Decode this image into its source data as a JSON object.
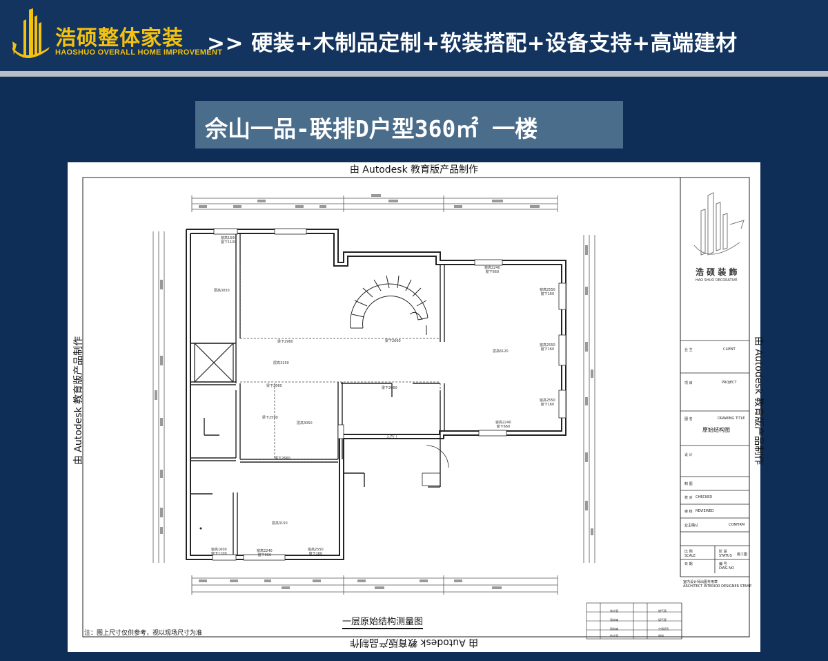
{
  "header": {
    "brand_cn": "浩硕整体家装",
    "brand_en": "HAOSHUO OVERALL HOME IMPROVEMENT",
    "tagline": ">> 硬装+木制品定制+软装搭配+设备支持+高端建材",
    "colors": {
      "background": "#12345f",
      "brand": "#f4c20d",
      "rule": "#b9bec6"
    }
  },
  "title": "佘山一品-联排D户型360㎡ 一楼",
  "sheet": {
    "watermark": "由 Autodesk 教育版产品制作",
    "caption": "一层原始结构测量图",
    "note": "注：图上尺寸仅供参考，视以现场尺寸为准",
    "entrance_label": "入户门",
    "rooms": [
      {
        "label": "层高3050"
      },
      {
        "label": "层高3150"
      },
      {
        "label": "层高6120"
      },
      {
        "label": "层高3050"
      },
      {
        "label": "层高3150"
      }
    ],
    "window_labels": [
      "窗高1600\n窗下1100",
      "窗高2240\n窗下660",
      "窗高2550\n窗下160",
      "窗高2550\n窗下160",
      "窗高2550\n窗下160",
      "窗高2240\n窗下660",
      "窗高1600\n窗下1100",
      "窗高2240\n窗下660",
      "窗高2550\n窗下160"
    ],
    "beam_labels": [
      "梁下2960",
      "梁下2660",
      "梁下2660",
      "梁下2660",
      "梁下2590",
      "梁下2660"
    ]
  },
  "title_block": {
    "brand_cn": "浩 硕 装 飾",
    "brand_en": "HAO SHUO DECORATIVE",
    "client_cn": "业 主",
    "client_en": "CLIENT",
    "project_cn": "项 目",
    "project_en": "PROJECT",
    "drawing_cn": "图 名",
    "drawing_en": "DRAWING TITLE",
    "drawing_title": "原始结构图",
    "design_cn": "设 计",
    "drafting_cn": "制 图",
    "checked_cn": "校 对",
    "checked_en": "CHECKED",
    "reviewed_cn": "审 核",
    "reviewed_en": "REVIEWED",
    "confirm_cn": "业主确认",
    "confirm_en": "CONFIRM",
    "scale_cn": "比 例",
    "scale_en": "SCALE",
    "status_cn": "阶 段",
    "status_en": "STATUS",
    "status_val": "施工图",
    "date_cn": "日 期",
    "dwgno_cn": "编 号",
    "dwgno_en": "DWG NO",
    "stamp_cn": "室内设计师出图专用章",
    "stamp_en": "ARCHITECT INTERIOR DESIGNER STAMP"
  },
  "legend": [
    {
      "label": "强电箱"
    },
    {
      "label": "燃气表"
    },
    {
      "label": "弱电箱"
    },
    {
      "label": "煤气管"
    },
    {
      "label": "给水管"
    },
    {
      "label": "空调留孔"
    },
    {
      "label": "排水管"
    },
    {
      "label": "烟道"
    }
  ]
}
